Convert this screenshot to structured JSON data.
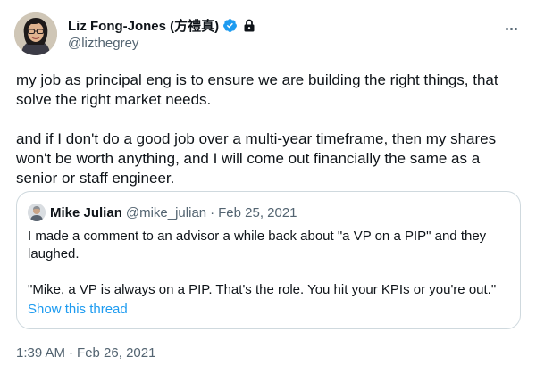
{
  "author": {
    "display_name": "Liz Fong-Jones (方禮真)",
    "handle": "@lizthegrey",
    "verified_icon": "verified-badge-icon",
    "protected_icon": "lock-icon"
  },
  "tweet": {
    "paragraphs": [
      "my job as principal eng is to ensure we are building the right things, that solve the right market needs.",
      "and if I don't do a good job over a multi-year timeframe, then my shares won't be worth anything, and I will come out financially the same as a senior or staff engineer."
    ],
    "time": "1:39 AM",
    "date": "Feb 26, 2021",
    "separator": "·"
  },
  "quoted": {
    "display_name": "Mike Julian",
    "handle": "@mike_julian",
    "separator": "·",
    "date": "Feb 25, 2021",
    "paragraphs": [
      "I made a comment to an advisor a while back about \"a VP on a PIP\" and they laughed.",
      "\"Mike, a VP is always on a PIP. That's the role. You hit your KPIs or you're out.\""
    ],
    "thread_link": "Show this thread"
  },
  "colors": {
    "text": "#0f1419",
    "secondary": "#536471",
    "link": "#1d9bf0",
    "border": "#cfd9de"
  }
}
